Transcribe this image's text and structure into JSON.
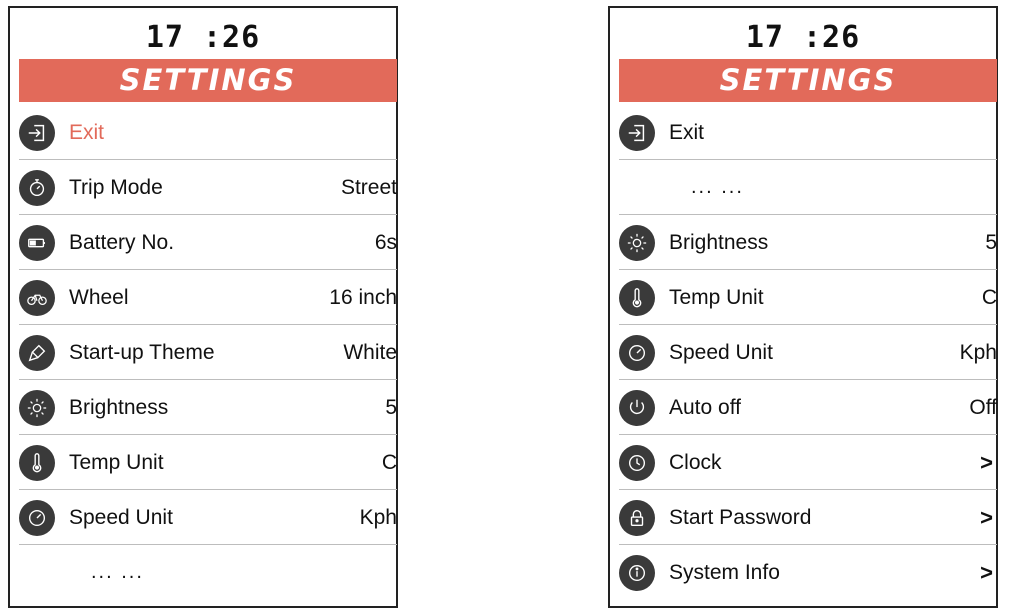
{
  "left": {
    "clock": "17 :26",
    "banner": "SETTINGS",
    "items": [
      {
        "label": "Exit",
        "value": "",
        "icon": "exit-icon"
      },
      {
        "label": "Trip Mode",
        "value": "Street",
        "icon": "stopwatch-icon"
      },
      {
        "label": "Battery No.",
        "value": "6s",
        "icon": "battery-icon"
      },
      {
        "label": "Wheel",
        "value": "16 inch",
        "icon": "bicycle-icon"
      },
      {
        "label": "Start-up Theme",
        "value": "White",
        "icon": "paint-brush-icon"
      },
      {
        "label": "Brightness",
        "value": "5",
        "icon": "sun-icon"
      },
      {
        "label": "Temp Unit",
        "value": "C",
        "icon": "thermometer-icon"
      },
      {
        "label": "Speed Unit",
        "value": "Kph",
        "icon": "speedometer-icon"
      }
    ],
    "ellipsis": "... ..."
  },
  "right": {
    "clock": "17 :26",
    "banner": "SETTINGS",
    "exit": {
      "label": "Exit",
      "icon": "exit-icon"
    },
    "ellipsis": "... ...",
    "items": [
      {
        "label": "Brightness",
        "value": "5",
        "icon": "sun-icon"
      },
      {
        "label": "Temp Unit",
        "value": "C",
        "icon": "thermometer-icon"
      },
      {
        "label": "Speed Unit",
        "value": "Kph",
        "icon": "speedometer-icon"
      },
      {
        "label": "Auto off",
        "value": "Off",
        "icon": "power-icon"
      },
      {
        "label": "Clock",
        "value": ">",
        "icon": "clock-icon"
      },
      {
        "label": "Start Password",
        "value": ">",
        "icon": "lock-icon"
      },
      {
        "label": "System Info",
        "value": ">",
        "icon": "info-icon"
      }
    ]
  },
  "colors": {
    "accent": "#e26a5a",
    "icon_bg": "#3a3a3a",
    "divider": "#bdbdbd"
  }
}
